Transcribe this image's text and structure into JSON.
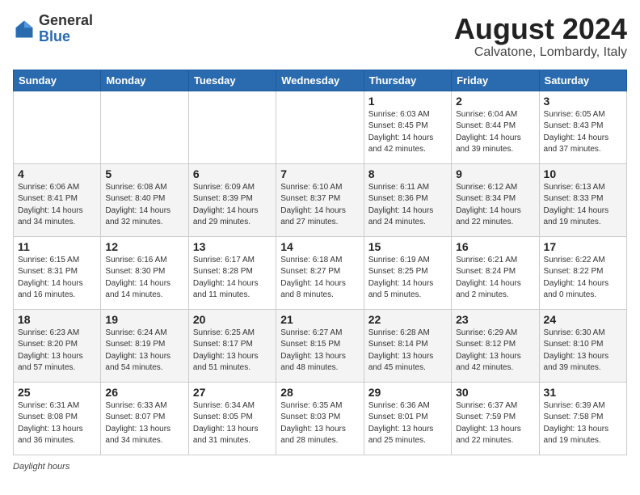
{
  "header": {
    "logo_general": "General",
    "logo_blue": "Blue",
    "month_year": "August 2024",
    "location": "Calvatone, Lombardy, Italy"
  },
  "footer": {
    "label": "Daylight hours"
  },
  "weekdays": [
    "Sunday",
    "Monday",
    "Tuesday",
    "Wednesday",
    "Thursday",
    "Friday",
    "Saturday"
  ],
  "weeks": [
    [
      {
        "day": "",
        "info": ""
      },
      {
        "day": "",
        "info": ""
      },
      {
        "day": "",
        "info": ""
      },
      {
        "day": "",
        "info": ""
      },
      {
        "day": "1",
        "info": "Sunrise: 6:03 AM\nSunset: 8:45 PM\nDaylight: 14 hours and 42 minutes."
      },
      {
        "day": "2",
        "info": "Sunrise: 6:04 AM\nSunset: 8:44 PM\nDaylight: 14 hours and 39 minutes."
      },
      {
        "day": "3",
        "info": "Sunrise: 6:05 AM\nSunset: 8:43 PM\nDaylight: 14 hours and 37 minutes."
      }
    ],
    [
      {
        "day": "4",
        "info": "Sunrise: 6:06 AM\nSunset: 8:41 PM\nDaylight: 14 hours and 34 minutes."
      },
      {
        "day": "5",
        "info": "Sunrise: 6:08 AM\nSunset: 8:40 PM\nDaylight: 14 hours and 32 minutes."
      },
      {
        "day": "6",
        "info": "Sunrise: 6:09 AM\nSunset: 8:39 PM\nDaylight: 14 hours and 29 minutes."
      },
      {
        "day": "7",
        "info": "Sunrise: 6:10 AM\nSunset: 8:37 PM\nDaylight: 14 hours and 27 minutes."
      },
      {
        "day": "8",
        "info": "Sunrise: 6:11 AM\nSunset: 8:36 PM\nDaylight: 14 hours and 24 minutes."
      },
      {
        "day": "9",
        "info": "Sunrise: 6:12 AM\nSunset: 8:34 PM\nDaylight: 14 hours and 22 minutes."
      },
      {
        "day": "10",
        "info": "Sunrise: 6:13 AM\nSunset: 8:33 PM\nDaylight: 14 hours and 19 minutes."
      }
    ],
    [
      {
        "day": "11",
        "info": "Sunrise: 6:15 AM\nSunset: 8:31 PM\nDaylight: 14 hours and 16 minutes."
      },
      {
        "day": "12",
        "info": "Sunrise: 6:16 AM\nSunset: 8:30 PM\nDaylight: 14 hours and 14 minutes."
      },
      {
        "day": "13",
        "info": "Sunrise: 6:17 AM\nSunset: 8:28 PM\nDaylight: 14 hours and 11 minutes."
      },
      {
        "day": "14",
        "info": "Sunrise: 6:18 AM\nSunset: 8:27 PM\nDaylight: 14 hours and 8 minutes."
      },
      {
        "day": "15",
        "info": "Sunrise: 6:19 AM\nSunset: 8:25 PM\nDaylight: 14 hours and 5 minutes."
      },
      {
        "day": "16",
        "info": "Sunrise: 6:21 AM\nSunset: 8:24 PM\nDaylight: 14 hours and 2 minutes."
      },
      {
        "day": "17",
        "info": "Sunrise: 6:22 AM\nSunset: 8:22 PM\nDaylight: 14 hours and 0 minutes."
      }
    ],
    [
      {
        "day": "18",
        "info": "Sunrise: 6:23 AM\nSunset: 8:20 PM\nDaylight: 13 hours and 57 minutes."
      },
      {
        "day": "19",
        "info": "Sunrise: 6:24 AM\nSunset: 8:19 PM\nDaylight: 13 hours and 54 minutes."
      },
      {
        "day": "20",
        "info": "Sunrise: 6:25 AM\nSunset: 8:17 PM\nDaylight: 13 hours and 51 minutes."
      },
      {
        "day": "21",
        "info": "Sunrise: 6:27 AM\nSunset: 8:15 PM\nDaylight: 13 hours and 48 minutes."
      },
      {
        "day": "22",
        "info": "Sunrise: 6:28 AM\nSunset: 8:14 PM\nDaylight: 13 hours and 45 minutes."
      },
      {
        "day": "23",
        "info": "Sunrise: 6:29 AM\nSunset: 8:12 PM\nDaylight: 13 hours and 42 minutes."
      },
      {
        "day": "24",
        "info": "Sunrise: 6:30 AM\nSunset: 8:10 PM\nDaylight: 13 hours and 39 minutes."
      }
    ],
    [
      {
        "day": "25",
        "info": "Sunrise: 6:31 AM\nSunset: 8:08 PM\nDaylight: 13 hours and 36 minutes."
      },
      {
        "day": "26",
        "info": "Sunrise: 6:33 AM\nSunset: 8:07 PM\nDaylight: 13 hours and 34 minutes."
      },
      {
        "day": "27",
        "info": "Sunrise: 6:34 AM\nSunset: 8:05 PM\nDaylight: 13 hours and 31 minutes."
      },
      {
        "day": "28",
        "info": "Sunrise: 6:35 AM\nSunset: 8:03 PM\nDaylight: 13 hours and 28 minutes."
      },
      {
        "day": "29",
        "info": "Sunrise: 6:36 AM\nSunset: 8:01 PM\nDaylight: 13 hours and 25 minutes."
      },
      {
        "day": "30",
        "info": "Sunrise: 6:37 AM\nSunset: 7:59 PM\nDaylight: 13 hours and 22 minutes."
      },
      {
        "day": "31",
        "info": "Sunrise: 6:39 AM\nSunset: 7:58 PM\nDaylight: 13 hours and 19 minutes."
      }
    ]
  ]
}
